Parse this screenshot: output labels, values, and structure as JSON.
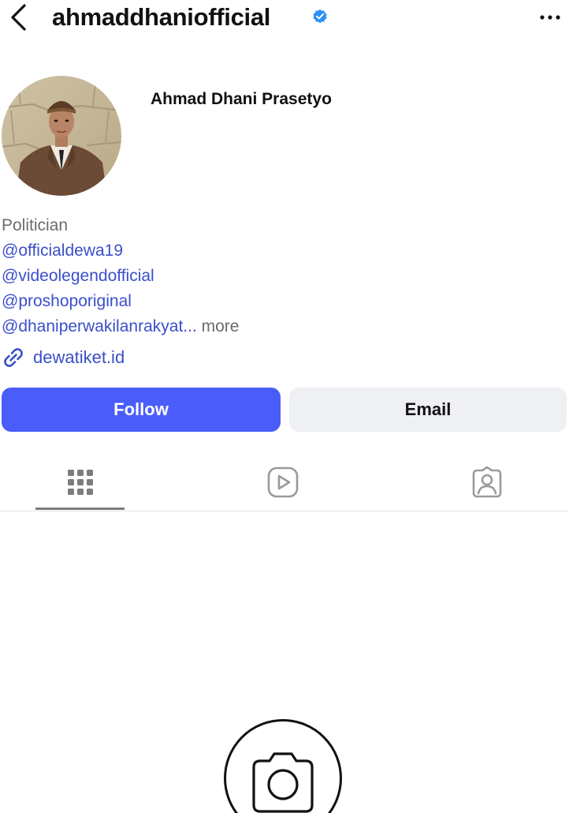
{
  "header": {
    "username": "ahmaddhaniofficial",
    "verified": true,
    "back_icon": "chevron-left-icon",
    "more_icon": "more-horizontal-icon"
  },
  "profile": {
    "display_name": "Ahmad Dhani Prasetyo",
    "avatar": "profile-photo"
  },
  "bio": {
    "category": "Politician",
    "mentions": [
      "@officialdewa19",
      "@videolegendofficial",
      "@proshoporiginal"
    ],
    "truncated_line": "@dhaniperwakilanrakyat...",
    "more_label": "more"
  },
  "link": {
    "icon": "link-icon",
    "text": "dewatiket.id"
  },
  "actions": {
    "follow_label": "Follow",
    "email_label": "Email"
  },
  "tabs": [
    {
      "icon": "grid-icon",
      "active": true
    },
    {
      "icon": "reels-icon",
      "active": false
    },
    {
      "icon": "tagged-person-icon",
      "active": false
    }
  ],
  "empty_state": {
    "icon": "camera-icon"
  },
  "colors": {
    "follow_button": "#4a5dfa",
    "email_button": "#eef0f4",
    "link_blue": "#3a4fc9",
    "verified_blue": "#2f8ff5",
    "secondary_text": "#6b6b6b"
  }
}
